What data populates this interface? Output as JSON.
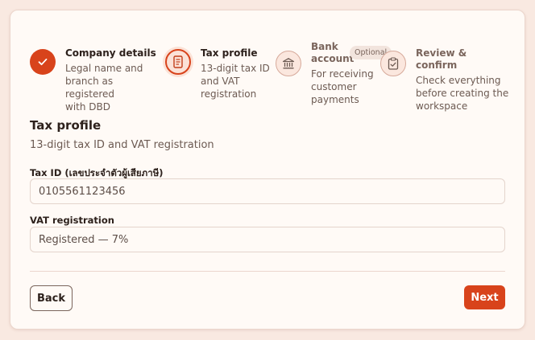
{
  "stepper": {
    "steps": [
      {
        "title": "Company details",
        "desc": [
          "Legal name and",
          "branch as registered",
          "with DBD"
        ],
        "state": "done",
        "icon": "check-icon"
      },
      {
        "title": "Tax profile",
        "desc": [
          "13-digit tax ID",
          "and VAT",
          "registration"
        ],
        "state": "active",
        "icon": "document-icon"
      },
      {
        "title": [
          "Bank",
          "account"
        ],
        "badge": "Optional",
        "desc": [
          "For receiving",
          "customer",
          "payments"
        ],
        "state": "pending",
        "icon": "bank-icon"
      },
      {
        "title": "Review & confirm",
        "desc": [
          "Check everything",
          "before creating the",
          "workspace"
        ],
        "state": "pending",
        "icon": "clipboard-check-icon"
      }
    ]
  },
  "form": {
    "title": "Tax profile",
    "subtitle": "13-digit tax ID and VAT registration",
    "tax_id": {
      "label": "Tax ID (เลขประจำตัวผู้เสียภาษี)",
      "value": "0105561123456"
    },
    "vat": {
      "label": "VAT registration",
      "value": "Registered — 7%"
    }
  },
  "actions": {
    "back_label": "Back",
    "next_label": "Next"
  },
  "colors": {
    "accent": "#d8431b",
    "background": "#f9e9e1",
    "card": "#fffaf6"
  }
}
